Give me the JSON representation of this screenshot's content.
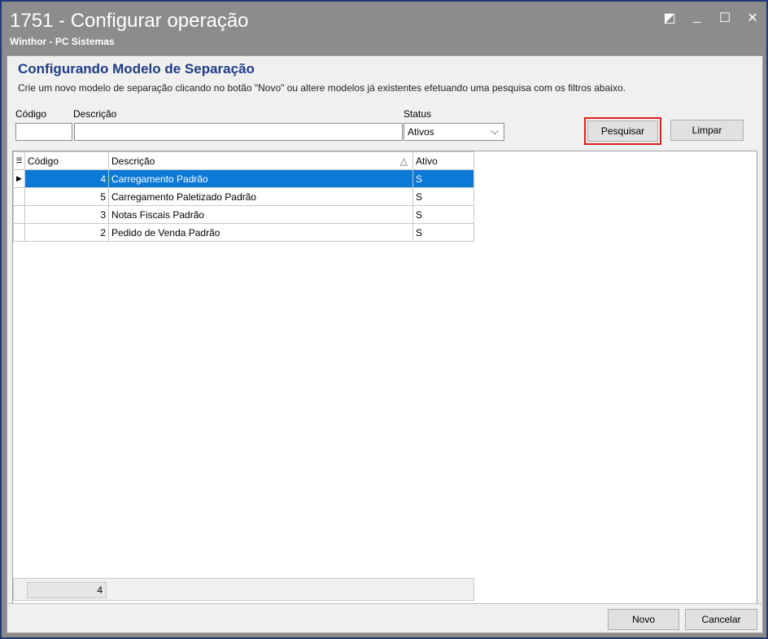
{
  "window": {
    "title": "1751 - Configurar operação",
    "subtitle": "Winthor - PC Sistemas",
    "controls": [
      "◩",
      "_",
      "☐",
      "✕"
    ]
  },
  "header": {
    "title": "Configurando Modelo de Separação",
    "description": "Crie um novo modelo de separação clicando no botão \"Novo\" ou altere modelos já existentes efetuando uma pesquisa com os filtros abaixo."
  },
  "filters": {
    "codigo_label": "Código",
    "codigo_value": "",
    "descricao_label": "Descrição",
    "descricao_value": "",
    "status_label": "Status",
    "status_value": "Ativos"
  },
  "buttons": {
    "pesquisar": "Pesquisar",
    "limpar": "Limpar",
    "novo": "Novo",
    "cancelar": "Cancelar"
  },
  "grid": {
    "columns": [
      "Código",
      "Descrição",
      "Ativo"
    ],
    "sort_indicator": "△",
    "rows": [
      {
        "codigo": "4",
        "descricao": "Carregamento Padrão",
        "ativo": "S"
      },
      {
        "codigo": "5",
        "descricao": "Carregamento Paletizado Padrão",
        "ativo": "S"
      },
      {
        "codigo": "3",
        "descricao": "Notas Fiscais Padrão",
        "ativo": "S"
      },
      {
        "codigo": "2",
        "descricao": "Pedido de Venda Padrão",
        "ativo": "S"
      }
    ],
    "footer_count": "4"
  },
  "colors": {
    "accent": "#1f3c88",
    "selection": "#0a79d7",
    "highlight": "#e0201b"
  }
}
